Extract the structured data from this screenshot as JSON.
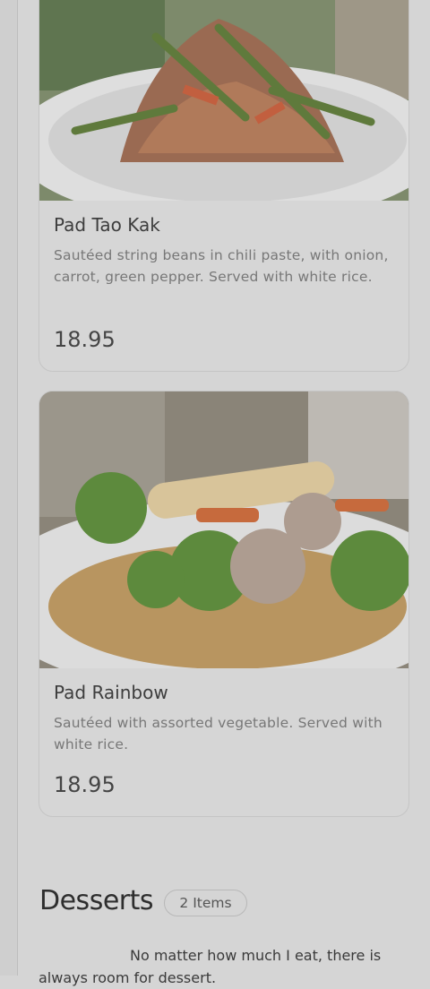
{
  "menu_items": [
    {
      "name": "Pad Tao Kak",
      "description": "Sautéed string beans in chili paste, with onion, carrot, green pepper. Served with white rice.",
      "price": "18.95"
    },
    {
      "name": "Pad Rainbow",
      "description": "Sautéed with assorted vegetable. Served with white rice.",
      "price": "18.95"
    }
  ],
  "desserts": {
    "title": "Desserts",
    "count": "2 Items",
    "description": "No matter how much I eat, there is always room for dessert."
  },
  "colors": {
    "page_overlay": "#d5d5d5",
    "card_border": "#c5c5c5",
    "text_dark": "#3a3a3a",
    "text_muted": "#777777"
  }
}
